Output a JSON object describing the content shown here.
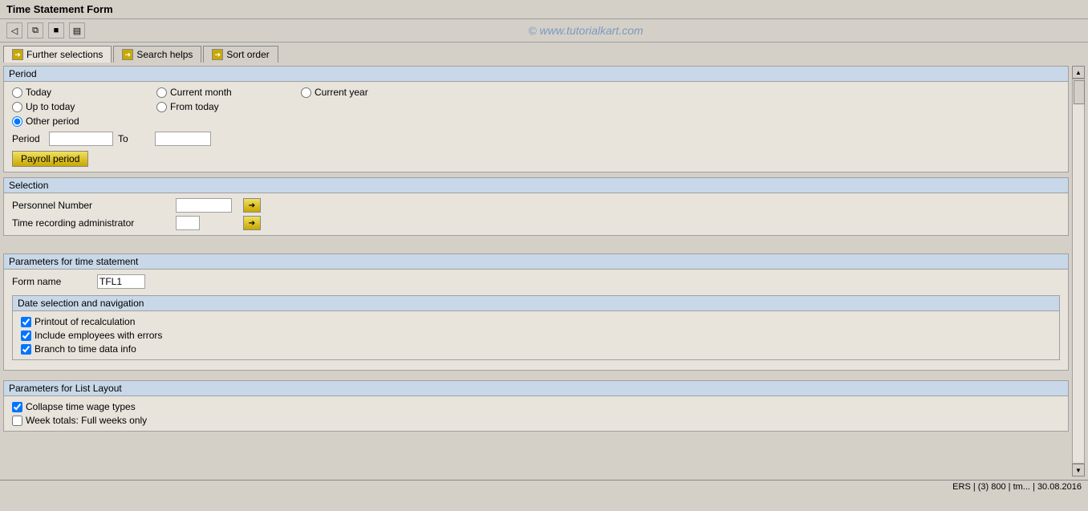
{
  "titleBar": {
    "title": "Time Statement Form"
  },
  "toolbar": {
    "watermark": "© www.tutorialkart.com",
    "icons": [
      "back-icon",
      "save-icon",
      "find-icon",
      "print-icon"
    ]
  },
  "tabs": [
    {
      "label": "Further selections",
      "active": true,
      "hasArrow": true
    },
    {
      "label": "Search helps",
      "active": false,
      "hasArrow": true
    },
    {
      "label": "Sort order",
      "active": false,
      "hasArrow": true
    }
  ],
  "period": {
    "sectionTitle": "Period",
    "options": [
      {
        "label": "Today",
        "checked": false
      },
      {
        "label": "Current month",
        "checked": false
      },
      {
        "label": "Current year",
        "checked": false
      },
      {
        "label": "Up to today",
        "checked": false
      },
      {
        "label": "From today",
        "checked": false
      },
      {
        "label": "Other period",
        "checked": true
      }
    ],
    "periodLabel": "Period",
    "toLabel": "To",
    "periodValue": "",
    "toValue": "",
    "payrollBtnLabel": "Payroll period"
  },
  "selection": {
    "sectionTitle": "Selection",
    "fields": [
      {
        "label": "Personnel Number",
        "value": "",
        "wide": true
      },
      {
        "label": "Time recording administrator",
        "value": "",
        "wide": false
      }
    ]
  },
  "parametersForTimeStatement": {
    "sectionTitle": "Parameters for time statement",
    "formNameLabel": "Form name",
    "formNameValue": "TFL1",
    "dateSelectionTitle": "Date selection and navigation",
    "checkboxes": [
      {
        "label": "Printout of recalculation",
        "checked": true
      },
      {
        "label": "Include employees with errors",
        "checked": true
      },
      {
        "label": "Branch to time data info",
        "checked": true
      }
    ]
  },
  "parametersForListLayout": {
    "sectionTitle": "Parameters for List Layout",
    "checkboxes": [
      {
        "label": "Collapse time wage types",
        "checked": true
      },
      {
        "label": "Week totals: Full weeks only",
        "checked": false
      }
    ]
  },
  "icons": {
    "back": "◁",
    "save": "💾",
    "find": "🔍",
    "print": "🖨",
    "arrow": "➔",
    "select": "➔"
  }
}
